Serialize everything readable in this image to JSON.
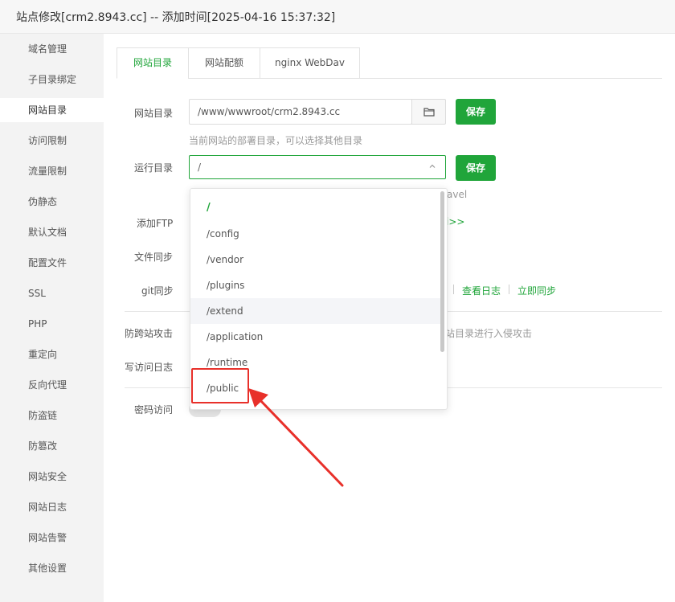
{
  "window": {
    "title": "站点修改[crm2.8943.cc] -- 添加时间[2025-04-16 15:37:32]"
  },
  "sidebar": {
    "items": [
      {
        "label": "域名管理"
      },
      {
        "label": "子目录绑定"
      },
      {
        "label": "网站目录",
        "active": true
      },
      {
        "label": "访问限制"
      },
      {
        "label": "流量限制"
      },
      {
        "label": "伪静态"
      },
      {
        "label": "默认文档"
      },
      {
        "label": "配置文件"
      },
      {
        "label": "SSL"
      },
      {
        "label": "PHP"
      },
      {
        "label": "重定向"
      },
      {
        "label": "反向代理"
      },
      {
        "label": "防盗链"
      },
      {
        "label": "防篡改"
      },
      {
        "label": "网站安全"
      },
      {
        "label": "网站日志"
      },
      {
        "label": "网站告警"
      },
      {
        "label": "其他设置"
      }
    ]
  },
  "tabs": [
    {
      "label": "网站目录",
      "active": true
    },
    {
      "label": "网站配额"
    },
    {
      "label": "nginx WebDav"
    }
  ],
  "site_dir": {
    "label": "网站目录",
    "value": "/www/wwwroot/crm2.8943.cc",
    "hint": "当前网站的部署目录，可以选择其他目录",
    "save_label": "保存"
  },
  "run_dir": {
    "label": "运行目录",
    "value": "/",
    "hint_tail": "avel",
    "save_label": "保存"
  },
  "ftp": {
    "label": "添加FTP",
    "link_tail": "i>>"
  },
  "file_sync": {
    "label": "文件同步"
  },
  "git_sync": {
    "label": "git同步",
    "view_log": "查看日志",
    "sync_now": "立即同步"
  },
  "anti_xss": {
    "label": "防跨站攻击",
    "hint_tail": "站目录进行入侵攻击"
  },
  "access_log": {
    "label": "写访问日志"
  },
  "password_access": {
    "label": "密码访问"
  },
  "dropdown": {
    "options": [
      "/",
      "/config",
      "/vendor",
      "/plugins",
      "/extend",
      "/application",
      "/runtime",
      "/public"
    ],
    "selected": "/",
    "hovered": "/extend",
    "highlighted": "/public"
  },
  "colors": {
    "accent": "#20a53a",
    "annotation": "#e8302a"
  }
}
